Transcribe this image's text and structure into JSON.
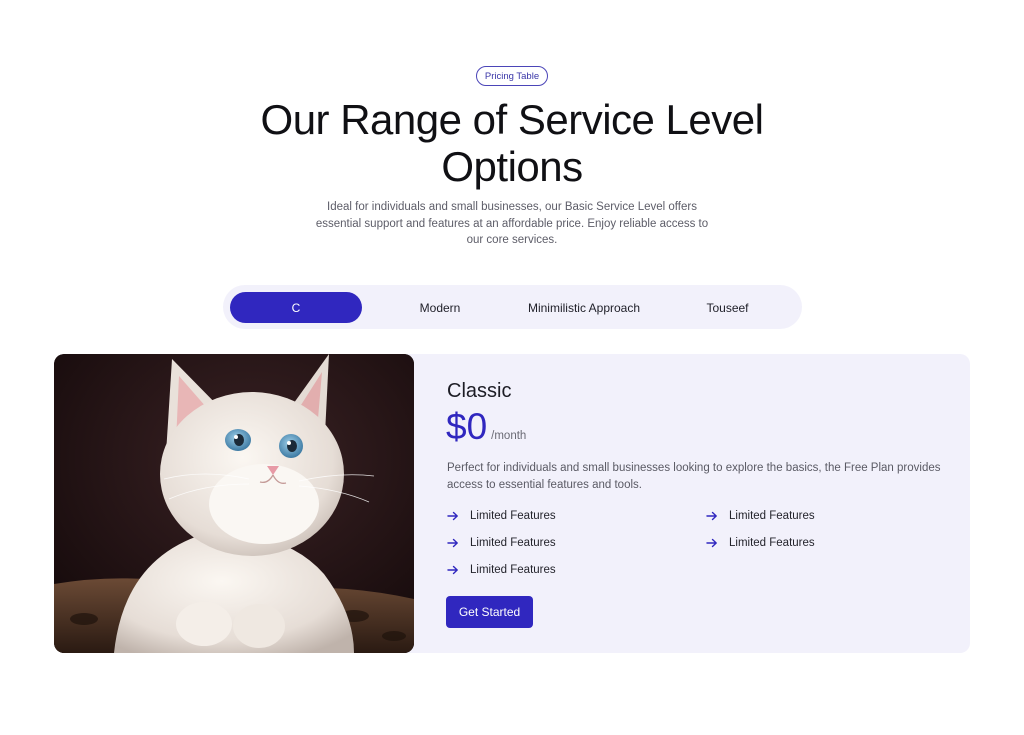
{
  "header": {
    "badge": "Pricing Table",
    "title_line1": "Our Range of Service Level",
    "title_line2": "Options",
    "subtitle": "Ideal for individuals and small businesses, our Basic Service Level offers essential support and features at an affordable price. Enjoy reliable access to our core services."
  },
  "tabs": [
    {
      "label": "C",
      "active": true
    },
    {
      "label": "Modern",
      "active": false
    },
    {
      "label": "Minimilistic Approach",
      "active": false
    },
    {
      "label": "Touseef",
      "active": false
    }
  ],
  "plan": {
    "name": "Classic",
    "price": "$0",
    "period": "/month",
    "description": "Perfect for individuals and small businesses looking to explore the basics, the Free Plan provides access to essential features and tools.",
    "features": [
      "Limited Features",
      "Limited Features",
      "Limited Features",
      "Limited Features",
      "Limited Features"
    ],
    "cta": "Get Started",
    "image_subject": "white kitten photo"
  },
  "colors": {
    "accent": "#3027bf",
    "card_background": "#f2f1fb",
    "heading": "#101014"
  },
  "icons": {
    "feature_bullet": "arrow-right-icon"
  }
}
